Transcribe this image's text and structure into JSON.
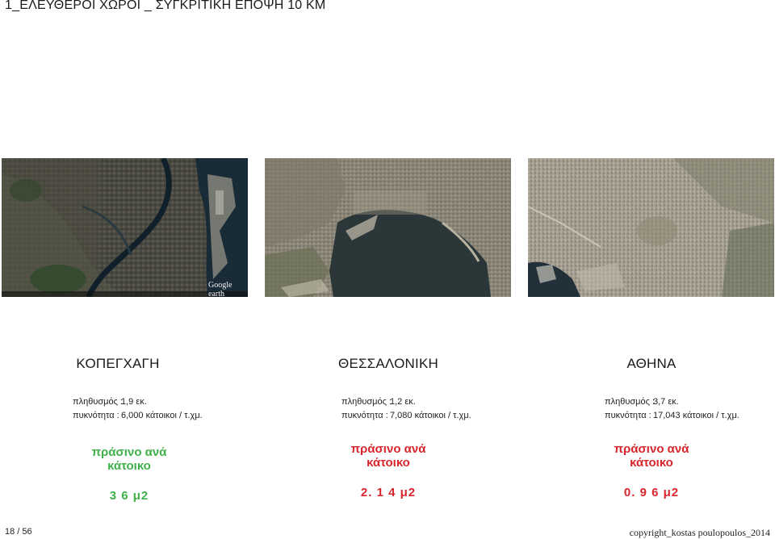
{
  "header": {
    "title": "1_ΕΛΕΥΘΕΡΟΙ ΧΩΡΟΙ _ ΣΥΓΚΡΙΤΙΚΗ ΕΠΟΨΗ 10 ΚΜ"
  },
  "cities": [
    {
      "name": "ΚΟΠΕΓΧΑΓΗ",
      "population_label": "πληθυσμός :",
      "population": "1,9 εκ.",
      "density_label": "πυκνότητα :",
      "density": "6,000 κάτοικοι / τ.χμ.",
      "metric_label_1": "πράσινο ανά",
      "metric_label_2": "κάτοικο",
      "metric_value": "3 6 μ2",
      "metric_color": "#3fb04a",
      "map_logo": "Google earth"
    },
    {
      "name": "ΘΕΣΣΑΛΟΝΙΚΗ",
      "population_label": "πληθυσμός :",
      "population": "1,2 εκ.",
      "density_label": "πυκνότητα :",
      "density": "7,080 κάτοικοι / τ.χμ.",
      "metric_label_1": "πράσινο ανά",
      "metric_label_2": "κάτοικο",
      "metric_value": "2. 1 4 μ2",
      "metric_color": "#d8262c"
    },
    {
      "name": "ΑΘΗΝΑ",
      "population_label": "πληθυσμός :",
      "population": "3,7 εκ.",
      "density_label": "πυκνότητα :",
      "density": "17,043 κάτοικοι / τ.χμ.",
      "metric_label_1": "πράσινο ανά",
      "metric_label_2": "κάτοικο",
      "metric_value": "0. 9 6 μ2",
      "metric_color": "#d8262c"
    }
  ],
  "footer": {
    "page": "18 / 56",
    "copyright": "copyright_kostas poulopoulos_2014"
  }
}
